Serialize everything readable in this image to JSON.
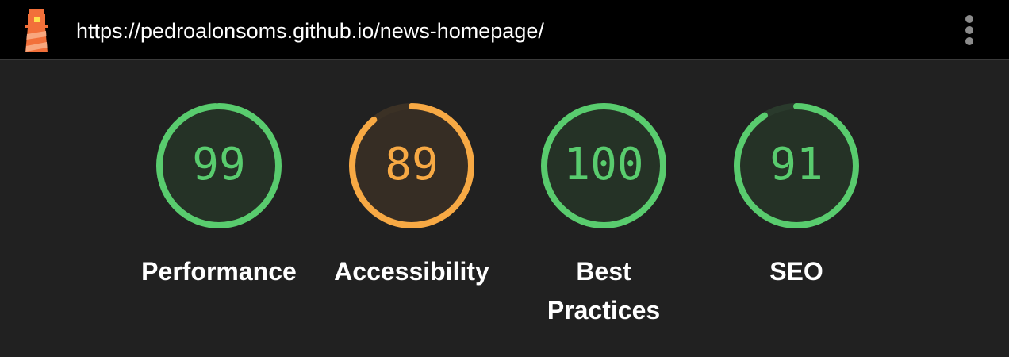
{
  "header": {
    "url": "https://pedroalonsoms.github.io/news-homepage/",
    "logo_icon": "lighthouse-icon",
    "menu_icon": "more-vert-icon"
  },
  "colors": {
    "pass": "#59CC6E",
    "pass_fill": "#253226",
    "average": "#F7A944",
    "average_fill": "#362D24",
    "track_pass": "#2a3a2c",
    "track_average": "#3b3125"
  },
  "gauges": [
    {
      "score": "99",
      "value": 99,
      "label": "Performance",
      "rating": "pass"
    },
    {
      "score": "89",
      "value": 89,
      "label": "Accessibility",
      "rating": "average"
    },
    {
      "score": "100",
      "value": 100,
      "label": "Best Practices",
      "rating": "pass"
    },
    {
      "score": "91",
      "value": 91,
      "label": "SEO",
      "rating": "pass"
    }
  ]
}
